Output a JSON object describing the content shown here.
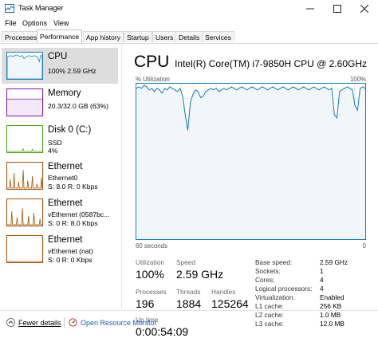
{
  "window": {
    "title": "Task Manager"
  },
  "menu": [
    "File",
    "Options",
    "View"
  ],
  "tabs": [
    "Processes",
    "Performance",
    "App history",
    "Startup",
    "Users",
    "Details",
    "Services"
  ],
  "sidebar": [
    {
      "title": "CPU",
      "sub1": "100% 2.59 GHz",
      "sub2": "",
      "color": "#117dbb"
    },
    {
      "title": "Memory",
      "sub1": "20.3/32.0 GB (63%)",
      "sub2": "",
      "color": "#8b12ae"
    },
    {
      "title": "Disk 0 (C:)",
      "sub1": "SSD",
      "sub2": "4%",
      "color": "#4da60c"
    },
    {
      "title": "Ethernet",
      "sub1": "Ethernet0",
      "sub2": "S: 8.0  R: 0 Kbps",
      "color": "#a74f01"
    },
    {
      "title": "Ethernet",
      "sub1": "vEthernet (0587bc...",
      "sub2": "S: 0  R: 8.0 Kbps",
      "color": "#a74f01"
    },
    {
      "title": "Ethernet",
      "sub1": "vEthernet (nat)",
      "sub2": "S: 0  R: 0 Kbps",
      "color": "#a74f01"
    }
  ],
  "main": {
    "title": "CPU",
    "cpu_name": "Intel(R) Core(TM) i7-9850H CPU @ 2.60GHz",
    "util_label": "% Utilization",
    "max_label": "100%",
    "time_label": "60 seconds",
    "zero_label": "0",
    "utilization_history": [
      97,
      98,
      97,
      99,
      98,
      96,
      97,
      95,
      97,
      96,
      94,
      97,
      96,
      98,
      97,
      96,
      95,
      97,
      92,
      80,
      70,
      88,
      93,
      96,
      95,
      91,
      92,
      95,
      96,
      97,
      96,
      97,
      95,
      96,
      97,
      96,
      97,
      98,
      97,
      96,
      97,
      98,
      97,
      96,
      97,
      98,
      97,
      96,
      97,
      98,
      97,
      96,
      97,
      98,
      97,
      96,
      97,
      98,
      97,
      96,
      97,
      98,
      97,
      96,
      97,
      98,
      97,
      96,
      97,
      98,
      97,
      96,
      97,
      98,
      97,
      96,
      97,
      80,
      78,
      95,
      96,
      97,
      98,
      97,
      96,
      86,
      83,
      97,
      98,
      97
    ],
    "stats": {
      "utilization": {
        "label": "Utilization",
        "value": "100%"
      },
      "speed": {
        "label": "Speed",
        "value": "2.59 GHz"
      },
      "processes": {
        "label": "Processes",
        "value": "196"
      },
      "threads": {
        "label": "Threads",
        "value": "1884"
      },
      "handles": {
        "label": "Handles",
        "value": "125264"
      },
      "uptime": {
        "label": "Up time",
        "value": "0:00:54:09"
      }
    },
    "info": [
      {
        "k": "Base speed:",
        "v": "2.59 GHz"
      },
      {
        "k": "Sockets:",
        "v": "1"
      },
      {
        "k": "Cores:",
        "v": "4"
      },
      {
        "k": "Logical processors:",
        "v": "4"
      },
      {
        "k": "Virtualization:",
        "v": "Enabled"
      },
      {
        "k": "L1 cache:",
        "v": "256 KB"
      },
      {
        "k": "L2 cache:",
        "v": "1.0 MB"
      },
      {
        "k": "L3 cache:",
        "v": "12.0 MB"
      }
    ]
  },
  "footer": {
    "fewer": "Fewer details",
    "monitor": "Open Resource Monitor"
  },
  "colors": {
    "cpu_line": "#117dbb",
    "cpu_fill": "#f1f6fa",
    "grid": "#d9eaf4",
    "link": "#1a5fb4"
  }
}
